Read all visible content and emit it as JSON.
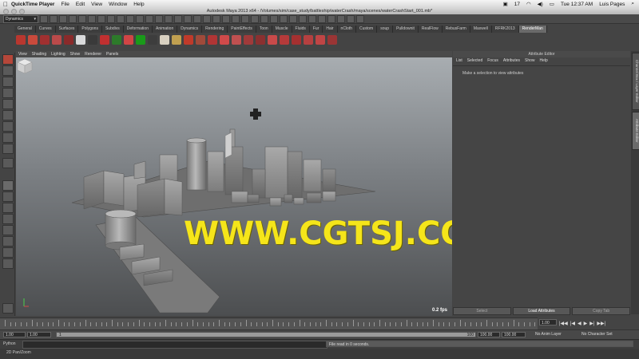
{
  "mac_menubar": {
    "app_name": "QuickTime Player",
    "menus": [
      "File",
      "Edit",
      "View",
      "Window",
      "Help"
    ],
    "badge": "17",
    "clock": "Tue 12:37 AM",
    "user": "Luis Pages"
  },
  "window": {
    "title": "Autodesk Maya 2013 x64 - /Volumes/sim/case_study/battleship/waterCrash/maya/scenes/waterCrashStart_001.mb*"
  },
  "status_line": {
    "menu_set": "Dynamics"
  },
  "shelf": {
    "tabs": [
      "General",
      "Curves",
      "Surfaces",
      "Polygons",
      "Subdivs",
      "Deformation",
      "Animation",
      "Dynamics",
      "Rendering",
      "PaintEffects",
      "Toon",
      "Muscle",
      "Fluids",
      "Fur",
      "Hair",
      "nCloth",
      "Custom",
      "soup",
      "Pulldownit",
      "RealFlow",
      "RebusFarm",
      "Maxwell",
      "RFRK2013",
      "RenderMan"
    ],
    "active_tab": "RenderMan",
    "icon_colors": [
      "#b8372f",
      "#c94a3c",
      "#a03030",
      "#ba4a4a",
      "#8a2a2a",
      "#d9dadb",
      "#3a3a3a",
      "#c03030",
      "#2d7a2a",
      "#d14545",
      "#1a9a1a",
      "#3d3d3d",
      "#d8d0c0",
      "#c0a050",
      "#c03a2a",
      "#a04a3a",
      "#b03535",
      "#d04a4a",
      "#c05050",
      "#a03a3a",
      "#8a3030",
      "#c84a4a",
      "#b53a3a",
      "#a53030",
      "#b54040",
      "#c04545",
      "#9a3535"
    ]
  },
  "viewport": {
    "panel_menu": [
      "View",
      "Shading",
      "Lighting",
      "Show",
      "Renderer",
      "Panels"
    ],
    "fps": "0.2 fps",
    "watermark": "WWW.CGTSJ.COM"
  },
  "attribute_editor": {
    "header": "Attribute Editor",
    "menu": [
      "List",
      "Selected",
      "Focus",
      "Attributes",
      "Show",
      "Help"
    ],
    "hint": "Make a selection to view attributes",
    "buttons": [
      "Select",
      "Load Attributes",
      "Copy Tab"
    ]
  },
  "side_tabs": [
    "Channel Box / Layer Editor",
    "Attribute Editor"
  ],
  "time_slider": {
    "current_frame": "1.00"
  },
  "range_slider": {
    "start_time": "1.00",
    "playback_start": "1.00",
    "range_start": "1",
    "range_end": "100",
    "playback_end": "100.00",
    "end_time": "100.00",
    "anim_layer": "No Anim Layer",
    "character_set": "No Character Set"
  },
  "command_line": {
    "language": "Python",
    "result": "File read in 0 seconds."
  },
  "help_line": {
    "text": "2D Pan/Zoom"
  }
}
